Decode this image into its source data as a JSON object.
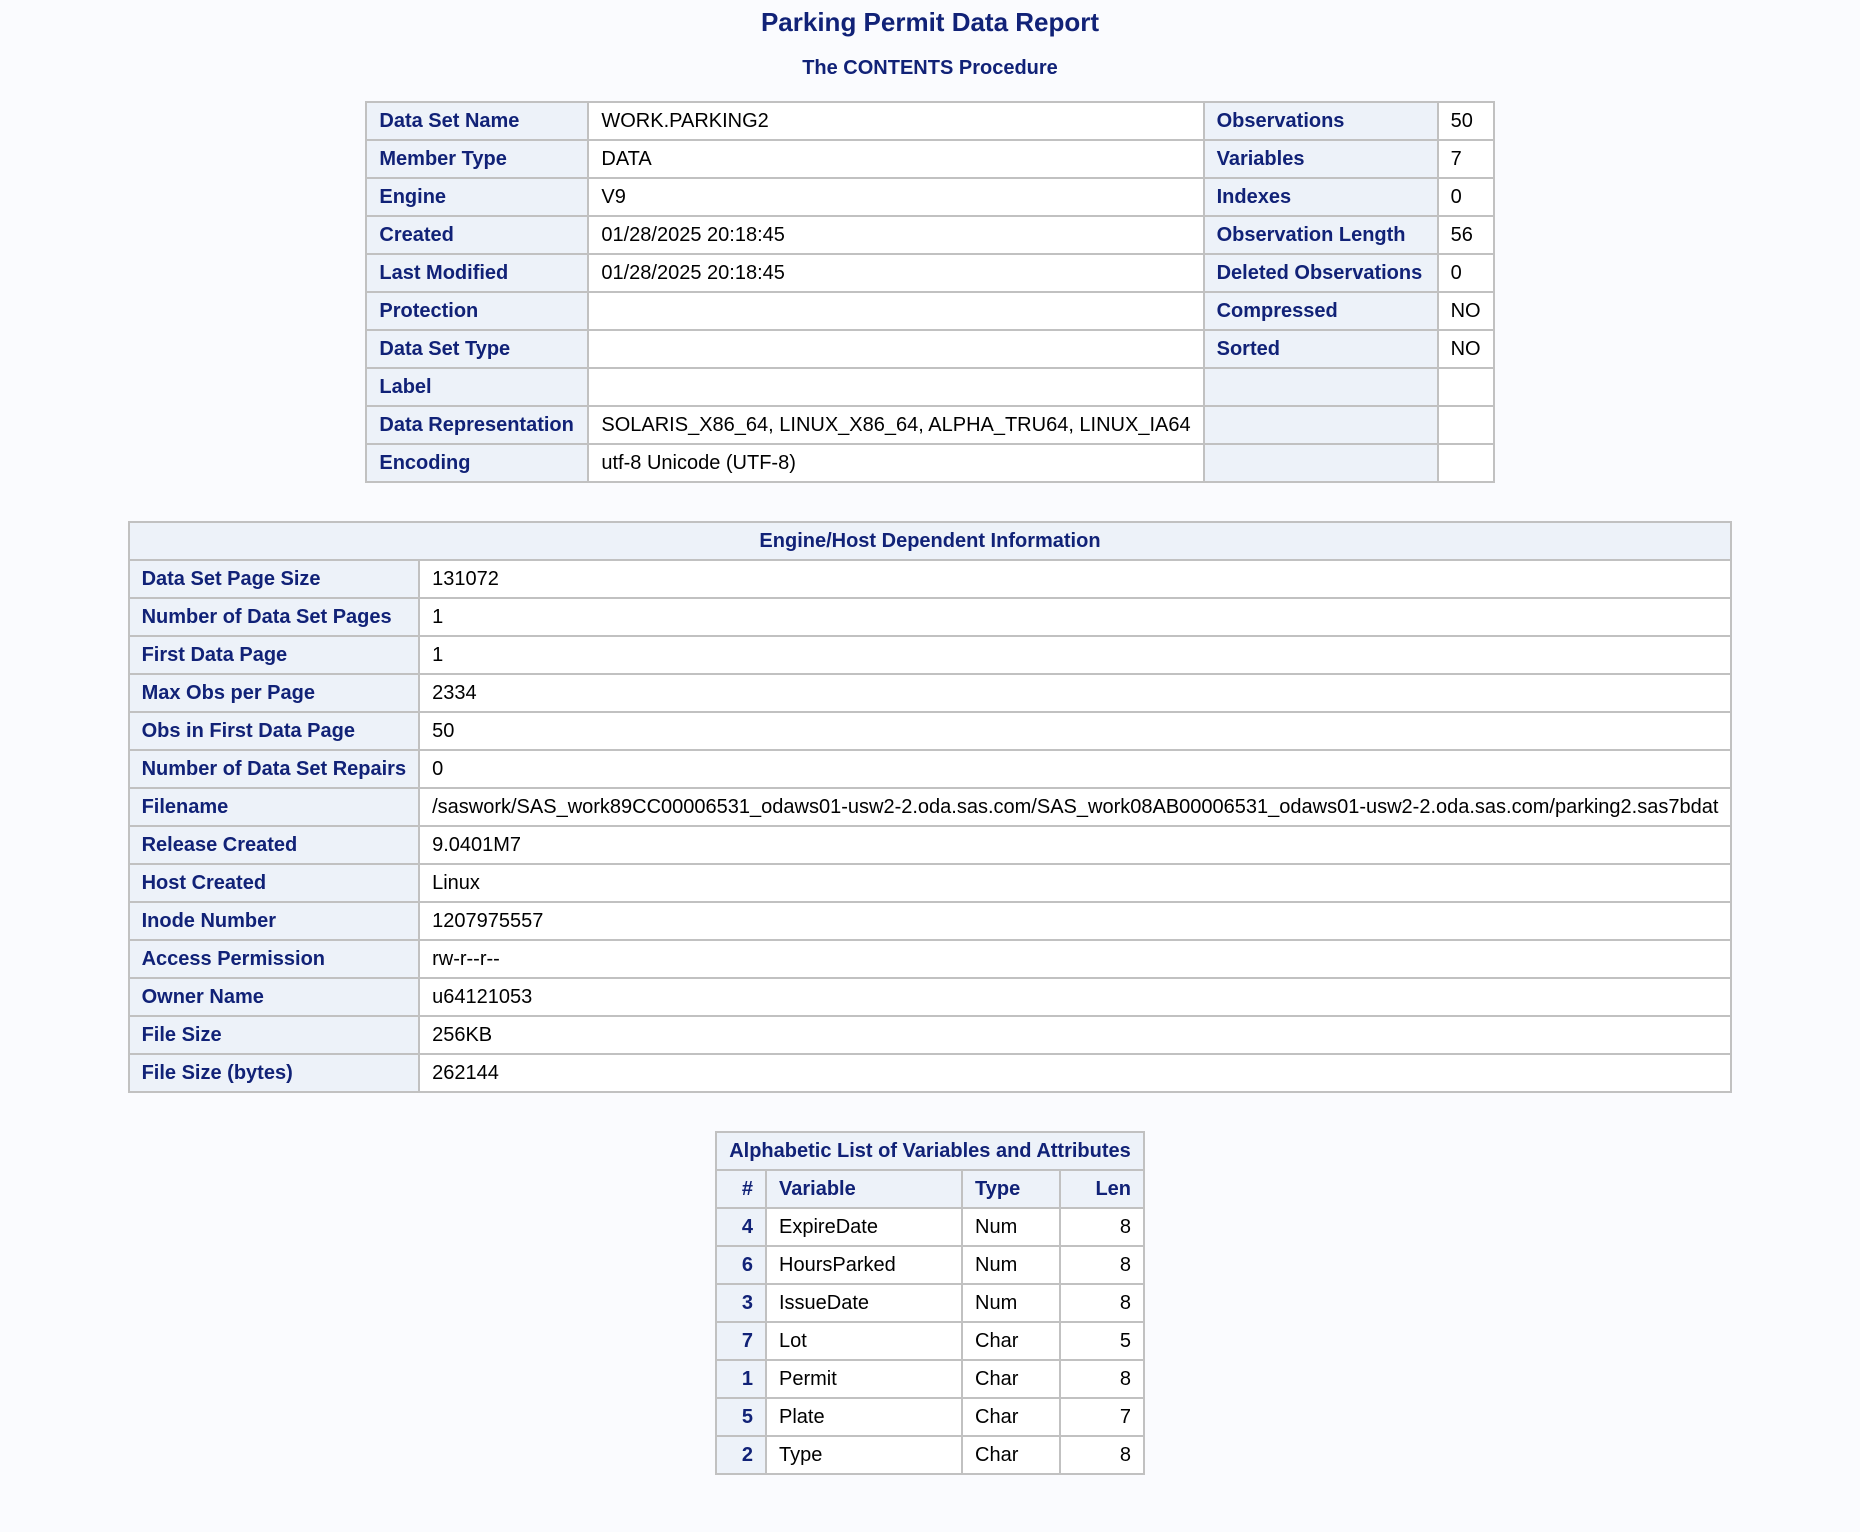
{
  "report": {
    "title": "Parking Permit Data Report",
    "subtitle": "The CONTENTS Procedure"
  },
  "contents": {
    "rows": [
      {
        "label1": "Data Set Name",
        "value1": "WORK.PARKING2",
        "label2": "Observations",
        "value2": "50"
      },
      {
        "label1": "Member Type",
        "value1": "DATA",
        "label2": "Variables",
        "value2": "7"
      },
      {
        "label1": "Engine",
        "value1": "V9",
        "label2": "Indexes",
        "value2": "0"
      },
      {
        "label1": "Created",
        "value1": "01/28/2025 20:18:45",
        "label2": "Observation Length",
        "value2": "56"
      },
      {
        "label1": "Last Modified",
        "value1": "01/28/2025 20:18:45",
        "label2": "Deleted Observations",
        "value2": "0"
      },
      {
        "label1": "Protection",
        "value1": "",
        "label2": "Compressed",
        "value2": "NO"
      },
      {
        "label1": "Data Set Type",
        "value1": "",
        "label2": "Sorted",
        "value2": "NO"
      },
      {
        "label1": "Label",
        "value1": "",
        "label2": "",
        "value2": ""
      },
      {
        "label1": "Data Representation",
        "value1": "SOLARIS_X86_64, LINUX_X86_64, ALPHA_TRU64, LINUX_IA64",
        "label2": "",
        "value2": ""
      },
      {
        "label1": "Encoding",
        "value1": "utf-8 Unicode (UTF-8)",
        "label2": "",
        "value2": ""
      }
    ]
  },
  "engine": {
    "caption": "Engine/Host Dependent Information",
    "rows": [
      {
        "label": "Data Set Page Size",
        "value": "131072"
      },
      {
        "label": "Number of Data Set Pages",
        "value": "1"
      },
      {
        "label": "First Data Page",
        "value": "1"
      },
      {
        "label": "Max Obs per Page",
        "value": "2334"
      },
      {
        "label": "Obs in First Data Page",
        "value": "50"
      },
      {
        "label": "Number of Data Set Repairs",
        "value": "0"
      },
      {
        "label": "Filename",
        "value": "/saswork/SAS_work89CC00006531_odaws01-usw2-2.oda.sas.com/SAS_work08AB00006531_odaws01-usw2-2.oda.sas.com/parking2.sas7bdat"
      },
      {
        "label": "Release Created",
        "value": "9.0401M7"
      },
      {
        "label": "Host Created",
        "value": "Linux"
      },
      {
        "label": "Inode Number",
        "value": "1207975557"
      },
      {
        "label": "Access Permission",
        "value": "rw-r--r--"
      },
      {
        "label": "Owner Name",
        "value": "u64121053"
      },
      {
        "label": "File Size",
        "value": "256KB"
      },
      {
        "label": "File Size (bytes)",
        "value": "262144"
      }
    ]
  },
  "variables": {
    "caption": "Alphabetic List of Variables and Attributes",
    "headers": {
      "num": "#",
      "variable": "Variable",
      "type": "Type",
      "len": "Len"
    },
    "rows": [
      {
        "num": "4",
        "variable": "ExpireDate",
        "type": "Num",
        "len": "8"
      },
      {
        "num": "6",
        "variable": "HoursParked",
        "type": "Num",
        "len": "8"
      },
      {
        "num": "3",
        "variable": "IssueDate",
        "type": "Num",
        "len": "8"
      },
      {
        "num": "7",
        "variable": "Lot",
        "type": "Char",
        "len": "5"
      },
      {
        "num": "1",
        "variable": "Permit",
        "type": "Char",
        "len": "8"
      },
      {
        "num": "5",
        "variable": "Plate",
        "type": "Char",
        "len": "7"
      },
      {
        "num": "2",
        "variable": "Type",
        "type": "Char",
        "len": "8"
      }
    ]
  }
}
